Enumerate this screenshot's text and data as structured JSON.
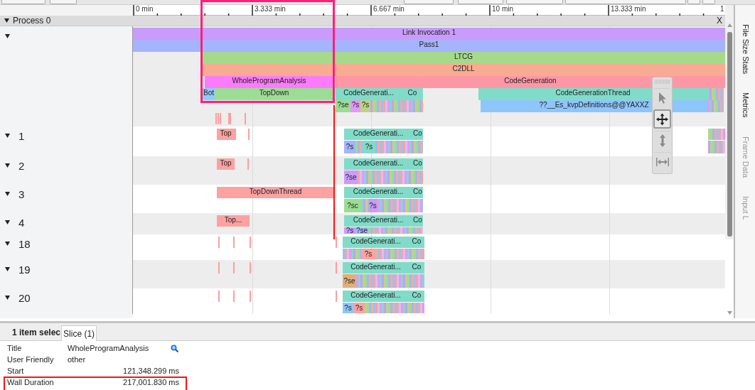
{
  "ruler": {
    "ticks": [
      "0 min",
      "3.333 min",
      "6.667 min",
      "10 min",
      "13.333 min",
      "1"
    ]
  },
  "process": {
    "title": "Process 0",
    "expanded": true,
    "close": "X"
  },
  "tracks": [
    {
      "expanded": true,
      "lanes": [
        {
          "slices": [
            {
              "label": "Link Invocation 1",
              "color": "#c99cfb"
            }
          ]
        },
        {
          "slices": [
            {
              "label": "Pass1",
              "color": "#a5b4fc"
            }
          ]
        },
        {
          "slices": [
            {
              "label": "LTCG",
              "color": "#a6d98a"
            }
          ]
        },
        {
          "slices": [
            {
              "label": "C2DLL",
              "color": "#f8ab93"
            }
          ]
        },
        {
          "slices": [
            {
              "label": "WholeProgramAnalysis",
              "color": "#fc7bfb"
            },
            {
              "label": "CodeGeneration",
              "color": "#fd97a6"
            }
          ]
        },
        {
          "slices": [
            {
              "label": "Bot",
              "color": "#8ecbf9"
            },
            {
              "label": "TopDown",
              "color": "#9bdd94"
            },
            {
              "label": "CodeGenerati...",
              "color": "#80dcc8"
            },
            {
              "label": "Co",
              "color": "#80dcc8"
            },
            {
              "label": "CodeGenerationThread",
              "color": "#80dcc8"
            }
          ]
        },
        {
          "slices": [
            {
              "label": "?se",
              "color": "#9bdd94"
            },
            {
              "label": "?s",
              "color": "#e597fb"
            },
            {
              "label": "?s",
              "color": "#b9d77f"
            },
            {
              "label": "??__Es_kvpDefinitions@@YAXXZ",
              "color": "#8ec6fb"
            }
          ]
        }
      ]
    },
    {
      "label": "1",
      "expanded": true,
      "lanes": [
        {
          "slices": [
            {
              "label": "Top",
              "color": "#fda1a1"
            },
            {
              "label": "CodeGenerati...",
              "color": "#80dcc8"
            },
            {
              "label": "Co",
              "color": "#80dcc8"
            }
          ]
        },
        {
          "slices": [
            {
              "label": "?s",
              "color": "#a5b4fc"
            },
            {
              "label": "?s",
              "color": "#80dcc8"
            }
          ]
        }
      ]
    },
    {
      "label": "2",
      "expanded": true,
      "lanes": [
        {
          "slices": [
            {
              "label": "Top",
              "color": "#fda1a1"
            },
            {
              "label": "CodeGenerati...",
              "color": "#80dcc8"
            },
            {
              "label": "Co",
              "color": "#80dcc8"
            }
          ]
        },
        {
          "slices": [
            {
              "label": "?se",
              "color": "#c99cfb"
            }
          ]
        }
      ]
    },
    {
      "label": "3",
      "expanded": true,
      "lanes": [
        {
          "slices": [
            {
              "label": "TopDownThread",
              "color": "#fda1a1"
            },
            {
              "label": "CodeGenerati...",
              "color": "#80dcc8"
            },
            {
              "label": "Co",
              "color": "#80dcc8"
            }
          ]
        },
        {
          "slices": [
            {
              "label": "?sc",
              "color": "#9bdd94"
            },
            {
              "label": "?s",
              "color": "#c99cfb"
            }
          ]
        }
      ]
    },
    {
      "label": "4",
      "expanded": true,
      "lanes": [
        {
          "slices": [
            {
              "label": "Top...",
              "color": "#fda1a1"
            },
            {
              "label": "CodeGenerati...",
              "color": "#80dcc8"
            },
            {
              "label": "Co",
              "color": "#80dcc8"
            }
          ]
        },
        {
          "slices": [
            {
              "label": "?s",
              "color": "#c99cfb"
            },
            {
              "label": "?se",
              "color": "#a5b4fc"
            }
          ]
        }
      ]
    },
    {
      "label": "18",
      "expanded": true,
      "lanes": [
        {
          "slices": [
            {
              "label": "CodeGenerati...",
              "color": "#80dcc8"
            },
            {
              "label": "Co",
              "color": "#80dcc8"
            }
          ]
        },
        {
          "slices": [
            {
              "label": "?s",
              "color": "#fda1a1"
            }
          ]
        }
      ]
    },
    {
      "label": "19",
      "expanded": true,
      "lanes": [
        {
          "slices": [
            {
              "label": "CodeGenerati...",
              "color": "#80dcc8"
            },
            {
              "label": "Co",
              "color": "#80dcc8"
            }
          ]
        },
        {
          "slices": [
            {
              "label": "?se",
              "color": "#e0b07a"
            }
          ]
        }
      ]
    },
    {
      "label": "20",
      "expanded": true,
      "lanes": [
        {
          "slices": [
            {
              "label": "CodeGenerati...",
              "color": "#80dcc8"
            },
            {
              "label": "Co",
              "color": "#80dcc8"
            }
          ]
        },
        {
          "slices": [
            {
              "label": "?s",
              "color": "#8ec6fb"
            },
            {
              "label": "?s",
              "color": "#fda1a1"
            }
          ]
        }
      ]
    }
  ],
  "tools": [
    {
      "kind": "pointer",
      "selected": false
    },
    {
      "kind": "pan",
      "selected": true
    },
    {
      "kind": "zoom",
      "selected": false
    },
    {
      "kind": "timing",
      "selected": false
    }
  ],
  "side_tabs": [
    {
      "label": "File Size Stats",
      "disabled": false
    },
    {
      "label": "Metrics",
      "disabled": false
    },
    {
      "label": "Frame Data",
      "disabled": true
    },
    {
      "label": "Input L",
      "disabled": true
    }
  ],
  "details": {
    "header": "1 item selec",
    "tabs": [
      {
        "label": "Slice (1)",
        "selected": true
      }
    ],
    "properties": [
      {
        "label": "Title",
        "value": "WholeProgramAnalysis",
        "kind": "text",
        "searchable": true
      },
      {
        "label": "User Friendly",
        "value": "other",
        "kind": "text",
        "searchable": false
      },
      {
        "label": "Start",
        "value": "121,348.299 ms",
        "kind": "number",
        "searchable": false
      },
      {
        "label": "Wall Duration",
        "value": "217,001.830 ms",
        "kind": "number",
        "searchable": false
      }
    ]
  }
}
